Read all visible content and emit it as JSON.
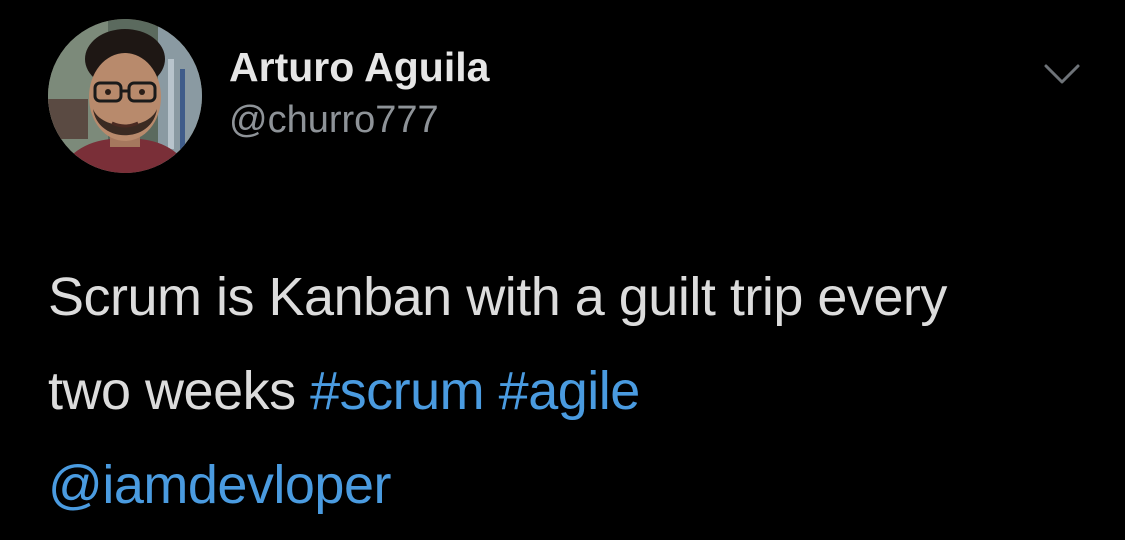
{
  "tweet": {
    "author": {
      "name": "Arturo Aguila",
      "handle": "@churro777"
    },
    "text": {
      "line1": "Scrum is Kanban with a guilt trip every",
      "line2_text": "two weeks",
      "hashtag1": "#scrum",
      "hashtag2": "#agile",
      "mention": "@iamdevloper"
    },
    "icons": {
      "avatar": "avatar-photo",
      "menu": "chevron-down-icon"
    },
    "colors": {
      "background": "#000000",
      "text": "#dcdcdc",
      "handle": "#8e9398",
      "link": "#4a9be0"
    }
  }
}
